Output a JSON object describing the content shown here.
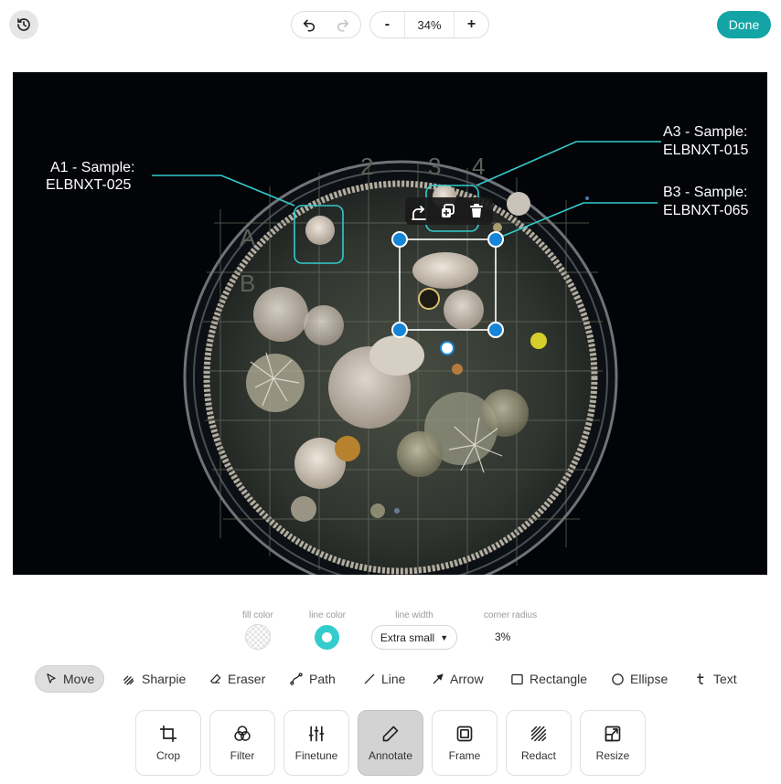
{
  "toolbar": {
    "history_icon": "history-icon",
    "undo_icon": "undo-icon",
    "redo_icon": "redo-icon",
    "zoom_out_label": "-",
    "zoom_value": "34%",
    "zoom_in_label": "+",
    "done_label": "Done"
  },
  "annotations": [
    {
      "line1": "A1 - Sample:",
      "line2": "ELBNXT-025"
    },
    {
      "line1": "A3 - Sample:",
      "line2": "ELBNXT-015"
    },
    {
      "line1": "B3 - Sample:",
      "line2": "ELBNXT-065"
    }
  ],
  "plate_grid_labels": [
    "2",
    "3",
    "4",
    "A",
    "B"
  ],
  "shape_actions": [
    "rotate-icon",
    "duplicate-icon",
    "trash-icon"
  ],
  "options": {
    "fill_color_label": "fill color",
    "line_color_label": "line color",
    "line_color": "#33cccc",
    "line_width_label": "line width",
    "line_width_value": "Extra small",
    "corner_radius_label": "corner radius",
    "corner_radius_value": "3%"
  },
  "tools": [
    {
      "label": "Move",
      "icon": "cursor-icon",
      "active": true
    },
    {
      "label": "Sharpie",
      "icon": "sharpie-icon"
    },
    {
      "label": "Eraser",
      "icon": "eraser-icon"
    },
    {
      "label": "Path",
      "icon": "path-icon"
    },
    {
      "label": "Line",
      "icon": "line-icon"
    },
    {
      "label": "Arrow",
      "icon": "arrow-icon"
    },
    {
      "label": "Rectangle",
      "icon": "rectangle-icon"
    },
    {
      "label": "Ellipse",
      "icon": "ellipse-icon"
    },
    {
      "label": "Text",
      "icon": "text-icon"
    }
  ],
  "modules": [
    {
      "label": "Crop",
      "icon": "crop-icon"
    },
    {
      "label": "Filter",
      "icon": "filter-icon"
    },
    {
      "label": "Finetune",
      "icon": "finetune-icon"
    },
    {
      "label": "Annotate",
      "icon": "pencil-icon",
      "active": true
    },
    {
      "label": "Frame",
      "icon": "frame-icon"
    },
    {
      "label": "Redact",
      "icon": "redact-icon"
    },
    {
      "label": "Resize",
      "icon": "resize-icon"
    }
  ],
  "colors": {
    "accent": "#13a5a5",
    "annotation_line": "#33cccc",
    "selection_handle": "#1585d8"
  }
}
